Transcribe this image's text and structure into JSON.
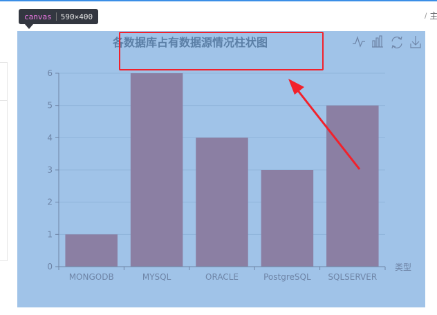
{
  "breadcrumb": {
    "separator": "/",
    "current": "主"
  },
  "devtools_tip": {
    "tag": "canvas",
    "dimensions": "590×400"
  },
  "toolbox": {
    "icons": [
      "line-chart-icon",
      "bar-chart-icon",
      "refresh-icon",
      "download-icon"
    ]
  },
  "colors": {
    "background": "#a0c3e8",
    "bar": "#8b7fa3",
    "title": "#5b7fa6",
    "axis": "#6e84a6",
    "grid": "#8fb4da",
    "annotation": "#f2212b"
  },
  "chart_data": {
    "type": "bar",
    "title": "各数据库占有数据源情况柱状图",
    "xlabel": "类型",
    "ylabel": "",
    "categories": [
      "MONGODB",
      "MYSQL",
      "ORACLE",
      "PostgreSQL",
      "SQLSERVER"
    ],
    "values": [
      1,
      6,
      4,
      3,
      5
    ],
    "ylim": [
      0,
      6
    ],
    "yticks": [
      0,
      1,
      2,
      3,
      4,
      5,
      6
    ],
    "grid": true
  }
}
